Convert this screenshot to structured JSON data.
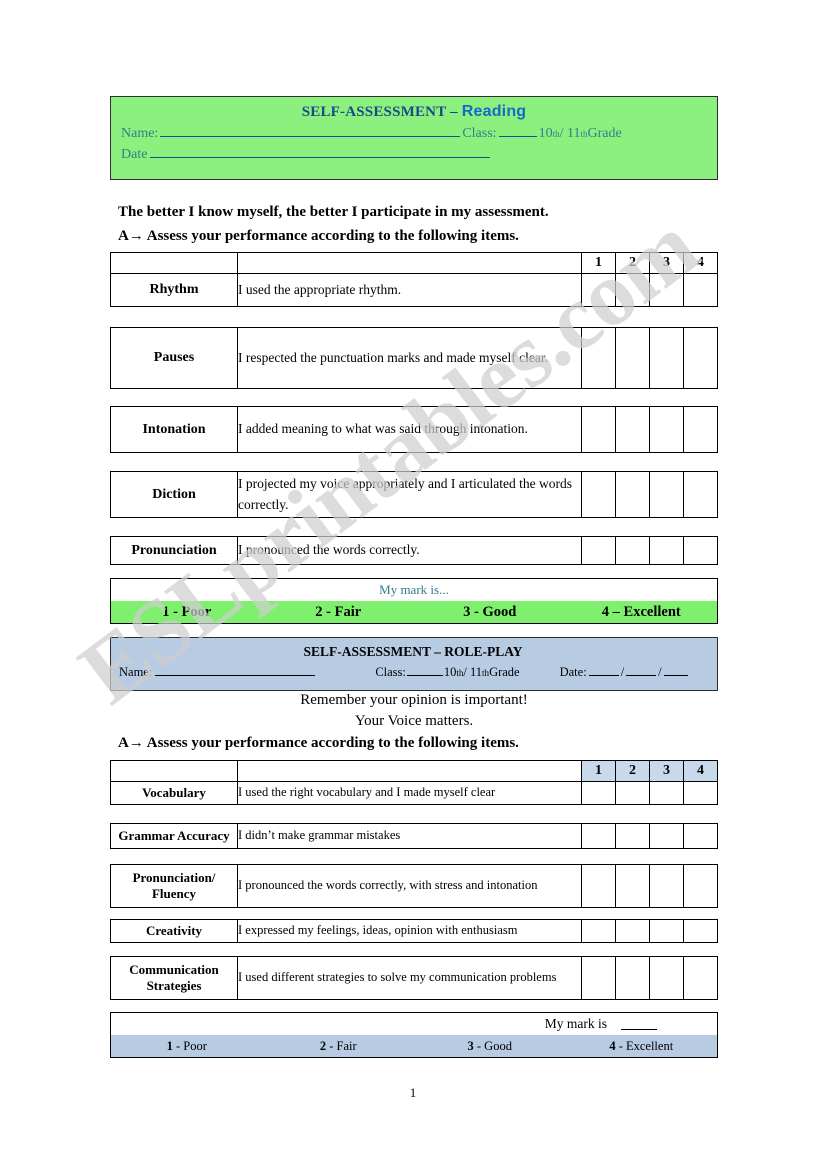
{
  "watermark": {
    "text": "ESLprintables.com"
  },
  "reading_section": {
    "header": {
      "title_main": "SELF-ASSESSMENT – ",
      "title_accent": "Reading",
      "name_label": "Name:",
      "class_label": "Class:",
      "grade_text_a": "10",
      "grade_sup_a": "th",
      "grade_sep": "/ 11",
      "grade_sup_b": "th",
      "grade_text_b": " Grade",
      "date_label": "Date"
    },
    "intro_line_1": "The better I know myself, the better I participate in my assessment.",
    "intro_line_2": "A→ Assess your performance according to the following items.",
    "score_headers": [
      "1",
      "2",
      "3",
      "4"
    ],
    "rows": [
      {
        "label": "Rhythm",
        "desc": "I used the appropriate rhythm."
      },
      {
        "label": "Pauses",
        "desc": "I respected the punctuation marks and made myself clear."
      },
      {
        "label": "Intonation",
        "desc": "I added meaning to what was said through intonation."
      },
      {
        "label": "Diction",
        "desc": "I projected my voice appropriately and I articulated the words correctly."
      },
      {
        "label": "Pronunciation",
        "desc": "I pronounced the words correctly."
      }
    ],
    "mark_bar": {
      "my_mark_label": "My mark is...",
      "scale": [
        "1 - Poor",
        "2 - Fair",
        "3 - Good",
        "4 – Excellent"
      ]
    }
  },
  "roleplay_section": {
    "header": {
      "title": "SELF-ASSESSMENT – ROLE-PLAY",
      "name_label": "Name:",
      "class_label": "Class:",
      "grade_text_a": "10",
      "grade_sup_a": "th",
      "grade_sep": "/ 11",
      "grade_sup_b": "th",
      "grade_text_b": " Grade",
      "date_label": "Date:",
      "date_sep_1": "/",
      "date_sep_2": "/"
    },
    "reminder_line_1": "Remember your opinion is important!",
    "reminder_line_2": "Your Voice matters.",
    "intro_line": "A→ Assess your performance according to the following items.",
    "score_headers": [
      "1",
      "2",
      "3",
      "4"
    ],
    "rows": [
      {
        "label": "Vocabulary",
        "desc": "I used the right vocabulary and I made myself clear"
      },
      {
        "label": "Grammar Accuracy",
        "desc": "I didn’t make grammar mistakes"
      },
      {
        "label": "Pronunciation/ Fluency",
        "desc": "I pronounced the words correctly, with stress and intonation"
      },
      {
        "label": "Creativity",
        "desc": "I expressed my feelings, ideas, opinion with enthusiasm"
      },
      {
        "label": "Communication Strategies",
        "desc": "I used different strategies to solve my communication problems"
      }
    ],
    "mark_bar": {
      "my_mark_label": "My mark is",
      "scale_numbers": [
        "1",
        "2",
        "3",
        "4"
      ],
      "scale_words": [
        "- Poor",
        "- Fair",
        "- Good",
        "- Excellent"
      ]
    }
  },
  "page_number": "1",
  "colors": {
    "green_header_bg": "#8cf07e",
    "green_scale_bg": "#7ef06e",
    "blue_header_bg": "#b7cbe3",
    "blue_score_head_bg": "#c9d9ec",
    "title_navy": "#184a86",
    "title_accent_blue": "#1569c7",
    "header_teal_text": "#2f7f8f",
    "watermark_gray": "#cfcfcf"
  }
}
